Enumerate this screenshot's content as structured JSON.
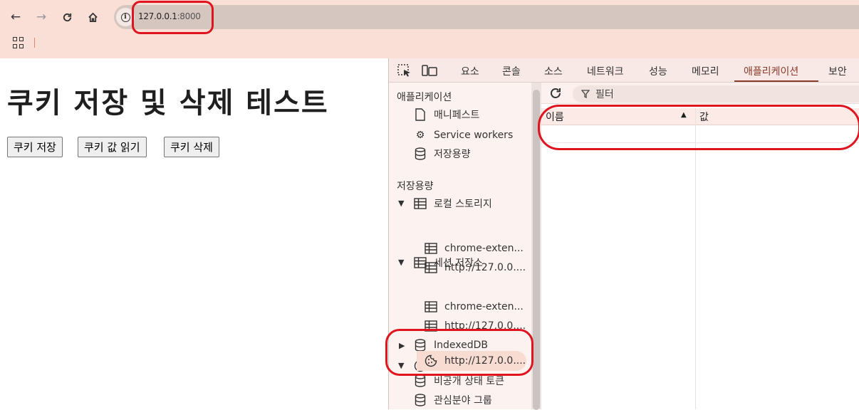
{
  "browser": {
    "url_host": "127.0.0.1",
    "url_port": ":8000"
  },
  "page": {
    "title": "쿠키 저장 및 삭제 테스트",
    "buttons": [
      "쿠키 저장",
      "쿠키 값 읽기",
      "쿠키 삭제"
    ]
  },
  "devtools": {
    "tabs": [
      "요소",
      "콘솔",
      "소스",
      "네트워크",
      "성능",
      "메모리",
      "애플리케이션",
      "보안"
    ],
    "active_tab": "애플리케이션",
    "accent": "#8a3b2c",
    "sidebar": {
      "app_header": "애플리케이션",
      "app_items": [
        "매니페스트",
        "Service workers",
        "저장용량"
      ],
      "storage_header": "저장용량",
      "local_storage": "로컬 스토리지",
      "local_children": [
        "chrome-exten...",
        "http://127.0.0...."
      ],
      "session_storage": "세션 저장소",
      "session_children": [
        "chrome-exten...",
        "http://127.0.0...."
      ],
      "indexeddb": "IndexedDB",
      "cookies": "쿠키",
      "cookie_child": "http://127.0.0....",
      "private_state": "비공개 상태 토큰",
      "interest_groups": "관심분야 그룹"
    },
    "filter_placeholder": "필터",
    "columns": [
      "이름",
      "값"
    ]
  },
  "highlight_color": "#e0141e"
}
